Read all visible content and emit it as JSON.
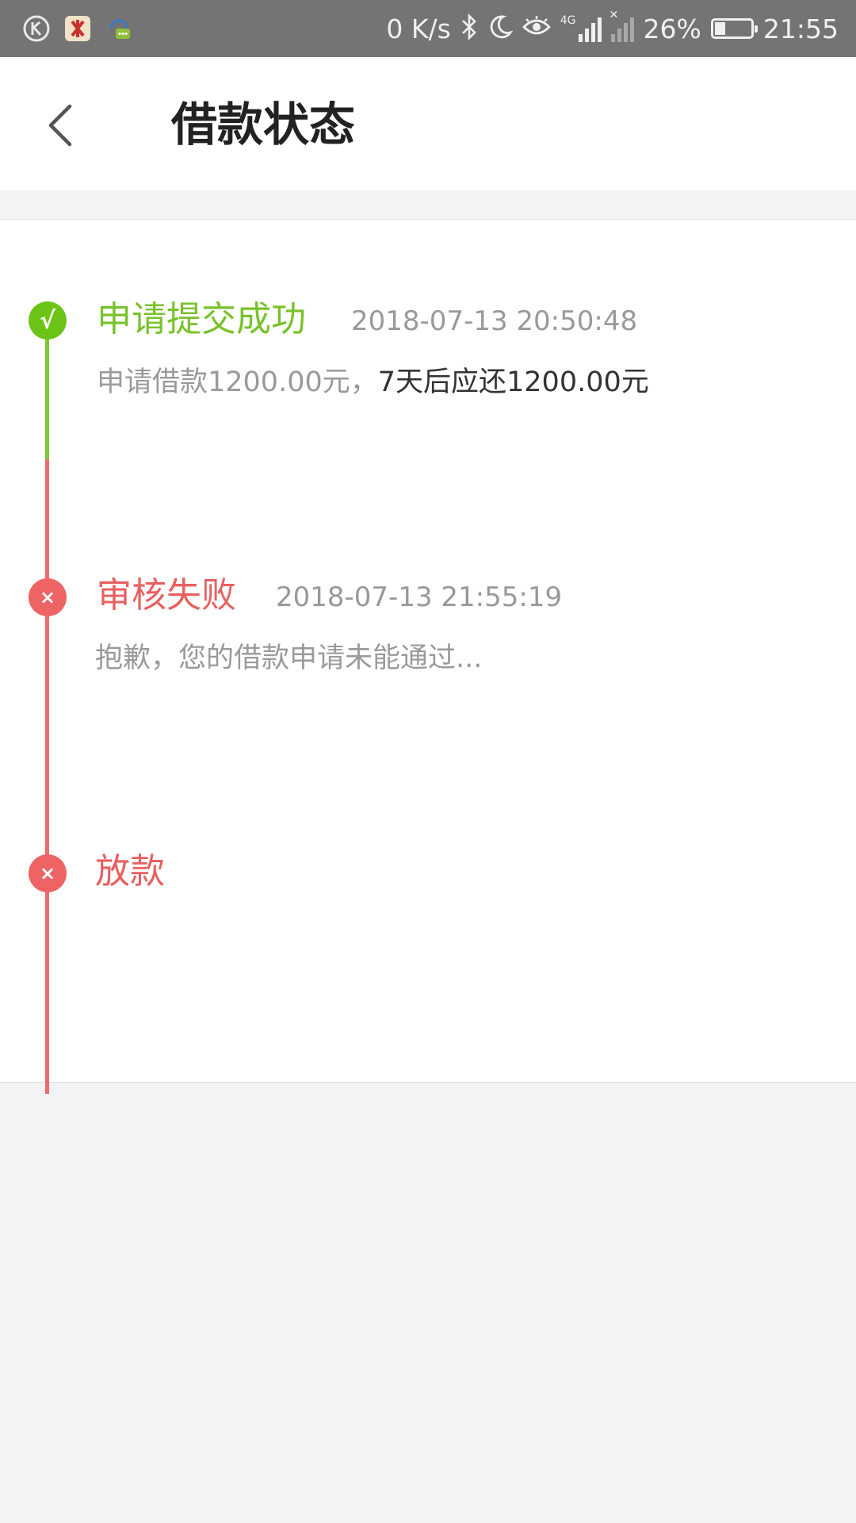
{
  "status_bar": {
    "net_speed": "0 K/s",
    "network": "4G",
    "battery": "26%",
    "time": "21:55",
    "icons": [
      "k-app-icon",
      "flower-app-icon",
      "message-app-icon",
      "bluetooth-icon",
      "moon-icon",
      "eye-icon",
      "signal-icon",
      "no-signal-icon",
      "battery-icon"
    ]
  },
  "header": {
    "back_icon": "chevron-left-icon",
    "title": "借款状态"
  },
  "timeline": [
    {
      "status": "success",
      "icon": "check-icon",
      "icon_glyph": "√",
      "title": "申请提交成功",
      "time": "2018-07-13 20:50:48",
      "desc_prefix": "申请借款1200.00元，",
      "desc_highlight": "7天后应还1200.00元"
    },
    {
      "status": "fail",
      "icon": "cross-icon",
      "icon_glyph": "×",
      "title": "审核失败",
      "time": "2018-07-13 21:55:19",
      "desc": "抱歉，您的借款申请未能通过..."
    },
    {
      "status": "fail",
      "icon": "cross-icon",
      "icon_glyph": "×",
      "title": "放款"
    }
  ],
  "colors": {
    "success": "#6cc417",
    "fail": "#ee6464",
    "status_bar": "#747474",
    "page_bg": "#f2f3f5"
  }
}
